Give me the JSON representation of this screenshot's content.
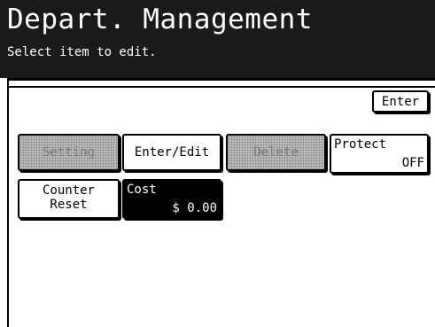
{
  "header": {
    "title": "Depart. Management",
    "subtitle": "Select item to edit."
  },
  "toolbar": {
    "enter_label": "Enter"
  },
  "actions": {
    "setting_label": "Setting",
    "edit_label": "Enter/Edit",
    "delete_label": "Delete",
    "protect_label": "Protect",
    "protect_value": "OFF",
    "counter_line1": "Counter",
    "counter_line2": "Reset",
    "cost_label": "Cost",
    "cost_value": "$ 0.00"
  }
}
